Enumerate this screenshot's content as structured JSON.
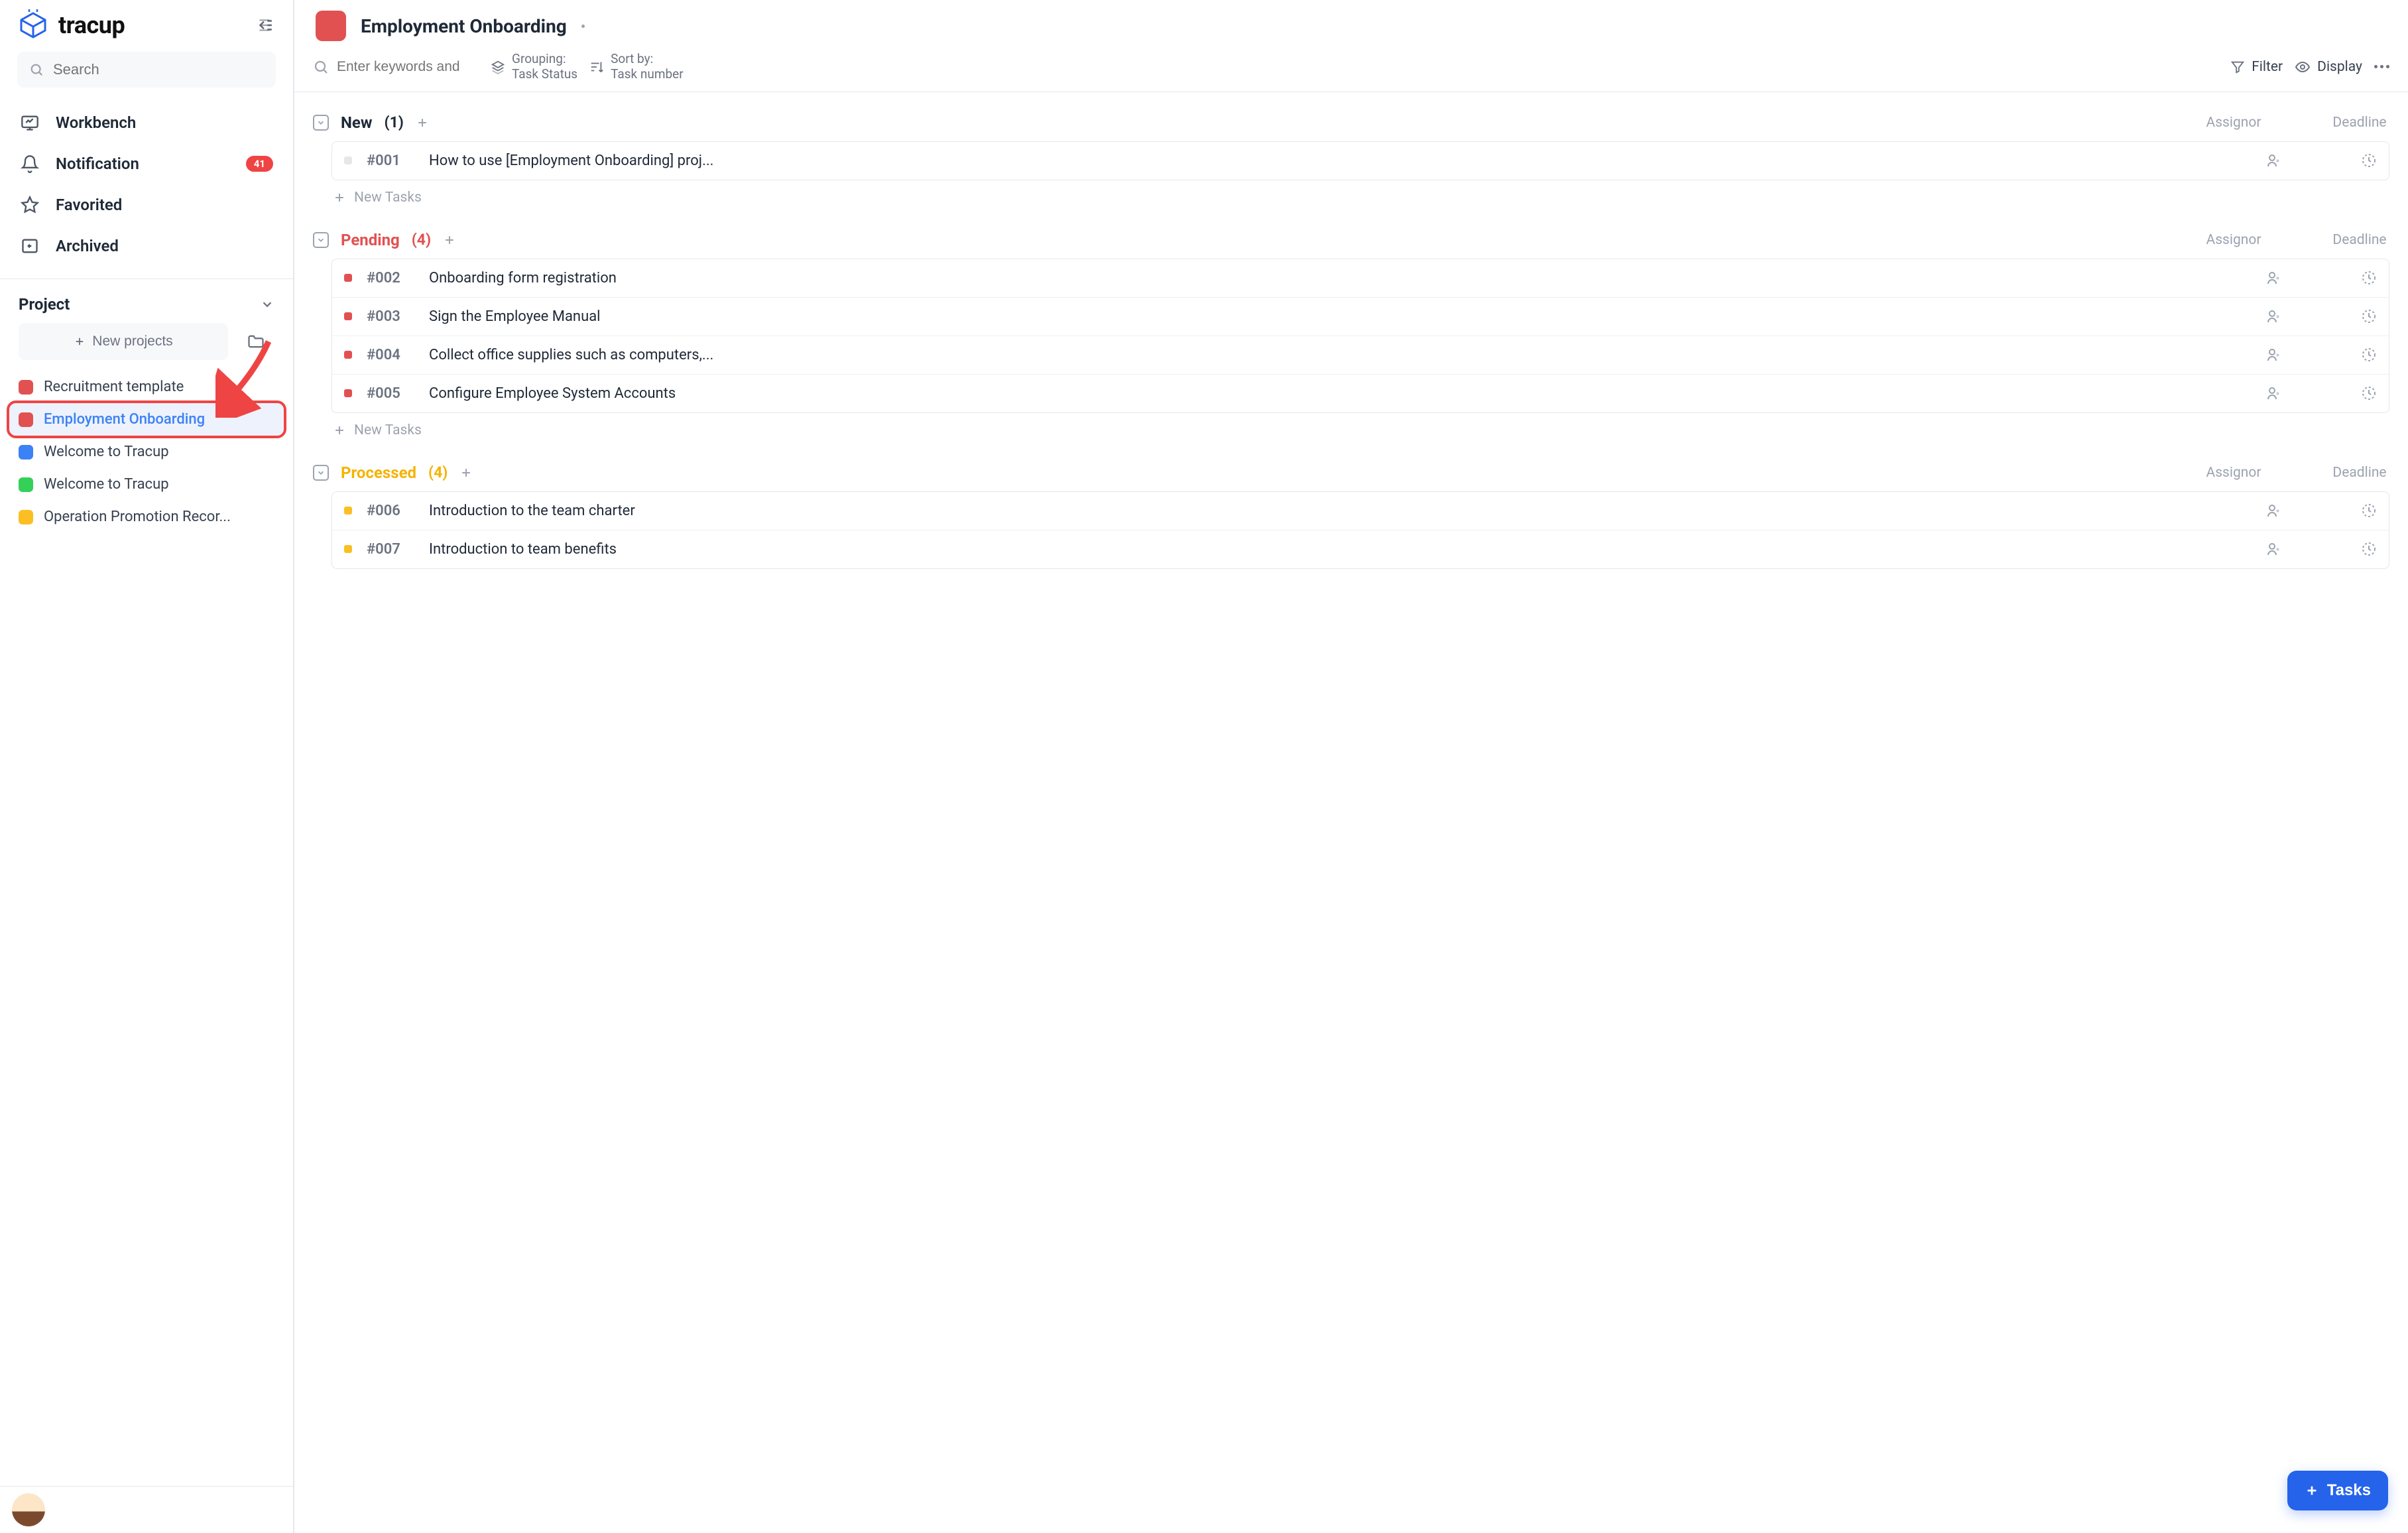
{
  "brand": {
    "name": "tracup"
  },
  "sidebar": {
    "search_placeholder": "Search",
    "nav": [
      {
        "key": "workbench",
        "label": "Workbench"
      },
      {
        "key": "notification",
        "label": "Notification",
        "badge": "41"
      },
      {
        "key": "favorited",
        "label": "Favorited"
      },
      {
        "key": "archived",
        "label": "Archived"
      }
    ],
    "project_section_label": "Project",
    "new_projects_label": "New projects",
    "projects": [
      {
        "label": "Recruitment template",
        "color": "#e15151",
        "active": false
      },
      {
        "label": "Employment Onboarding",
        "color": "#e15151",
        "active": true,
        "highlighted": true
      },
      {
        "label": "Welcome to Tracup",
        "color": "#3b82f6",
        "active": false
      },
      {
        "label": "Welcome to Tracup",
        "color": "#34d058",
        "active": false
      },
      {
        "label": "Operation Promotion Recor...",
        "color": "#fbbf24",
        "active": false
      }
    ]
  },
  "header": {
    "title": "Employment Onboarding",
    "color": "#e15151"
  },
  "toolbar": {
    "search_placeholder": "Enter keywords and",
    "grouping_label": "Grouping:",
    "grouping_value": "Task Status",
    "sort_label": "Sort by:",
    "sort_value": "Task number",
    "filter_label": "Filter",
    "display_label": "Display"
  },
  "columns": {
    "assignor": "Assignor",
    "deadline": "Deadline"
  },
  "new_tasks_label": "New Tasks",
  "groups": [
    {
      "name": "New",
      "count": "(1)",
      "color": "#1f2937",
      "dot": "#e5e7eb",
      "tasks": [
        {
          "id": "#001",
          "title": "How to use [Employment Onboarding] proj..."
        }
      ]
    },
    {
      "name": "Pending",
      "count": "(4)",
      "color": "#e15151",
      "dot": "#e15151",
      "tasks": [
        {
          "id": "#002",
          "title": "Onboarding form registration"
        },
        {
          "id": "#003",
          "title": "Sign the Employee Manual"
        },
        {
          "id": "#004",
          "title": "Collect office supplies such as computers,..."
        },
        {
          "id": "#005",
          "title": "Configure Employee System Accounts"
        }
      ]
    },
    {
      "name": "Processed",
      "count": "(4)",
      "color": "#f5b301",
      "dot": "#fbbf24",
      "tasks": [
        {
          "id": "#006",
          "title": "Introduction to the team charter"
        },
        {
          "id": "#007",
          "title": "Introduction to team benefits"
        }
      ]
    }
  ],
  "fab": {
    "label": "Tasks"
  }
}
